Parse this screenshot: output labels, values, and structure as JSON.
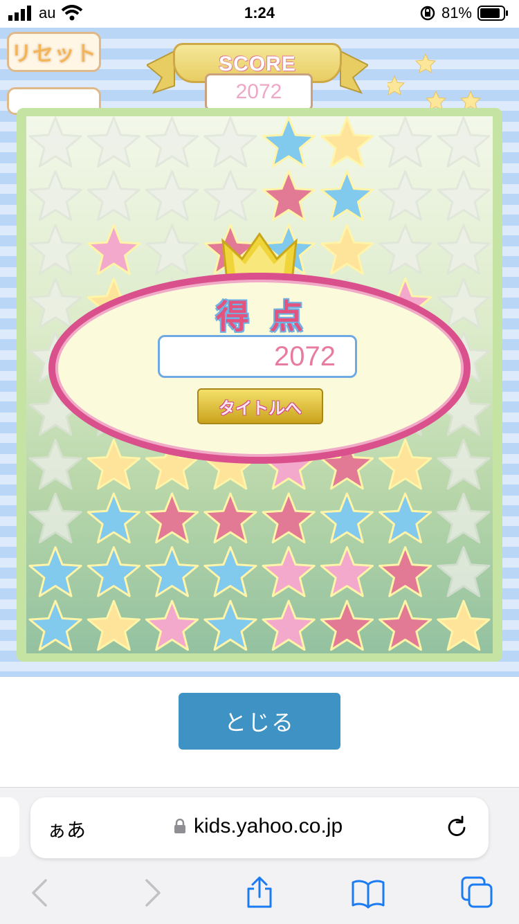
{
  "status_bar": {
    "carrier": "au",
    "time": "1:24",
    "battery_percent": "81%"
  },
  "game": {
    "reset_label": "リセット",
    "score_label": "SCORE",
    "score_value": "2072",
    "result": {
      "heading": "得点",
      "score": "2072",
      "title_button": "タイトルへ"
    },
    "board_colors": {
      "blue": "#82c9ee",
      "yellow": "#fde49a",
      "pink": "#f3a9cc",
      "red": "#e27a95",
      "gray": "#eef0ea"
    },
    "board_grid": [
      [
        "gray",
        "gray",
        "gray",
        "gray",
        "blue",
        "yellow",
        "gray",
        "gray"
      ],
      [
        "gray",
        "gray",
        "gray",
        "gray",
        "red",
        "blue",
        "gray",
        "gray"
      ],
      [
        "gray",
        "pink",
        "gray",
        "red",
        "blue",
        "yellow",
        "gray",
        "gray"
      ],
      [
        "gray",
        "yellow",
        "gray",
        "gray",
        "gray",
        "gray",
        "pink",
        "gray"
      ],
      [
        "gray",
        "gray",
        "gray",
        "gray",
        "gray",
        "gray",
        "gray",
        "gray"
      ],
      [
        "gray",
        "gray",
        "gray",
        "gray",
        "gray",
        "gray",
        "gray",
        "gray"
      ],
      [
        "gray",
        "yellow",
        "yellow",
        "yellow",
        "pink",
        "red",
        "yellow",
        "gray"
      ],
      [
        "gray",
        "blue",
        "red",
        "red",
        "red",
        "blue",
        "blue",
        "gray"
      ],
      [
        "blue",
        "blue",
        "blue",
        "blue",
        "pink",
        "pink",
        "red",
        "gray"
      ],
      [
        "blue",
        "yellow",
        "pink",
        "blue",
        "pink",
        "red",
        "red",
        "yellow"
      ]
    ]
  },
  "close_button": "とじる",
  "browser": {
    "aa_label": "ぁあ",
    "url": "kids.yahoo.co.jp"
  }
}
